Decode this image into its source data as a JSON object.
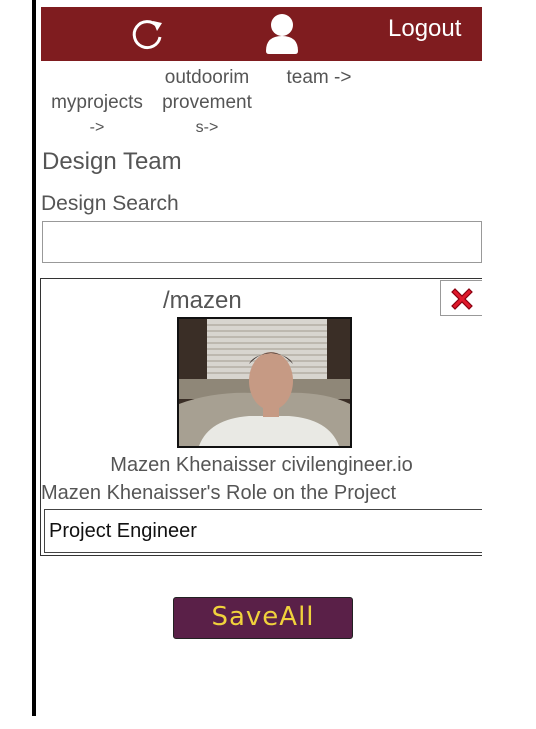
{
  "header": {
    "refresh_icon": "refresh-icon",
    "user_icon": "user-icon",
    "logout_label": "Logout",
    "bg_color": "#7f1c1f"
  },
  "breadcrumbs": [
    {
      "lines": [
        "myprojects",
        "->"
      ]
    },
    {
      "lines": [
        "outdoorim",
        "provement",
        "s->"
      ]
    },
    {
      "lines": [
        "team ->"
      ]
    }
  ],
  "page_title": "Design Team",
  "search": {
    "label": "Design Search",
    "value": "",
    "placeholder": ""
  },
  "member": {
    "handle": "/mazen",
    "close_icon": "close-x-icon",
    "name_line": "Mazen Khenaisser civilengineer.io",
    "role_label": "Mazen Khenaisser's Role on the Project",
    "role_value": "Project Engineer"
  },
  "save_all_label": "SaveAll",
  "colors": {
    "save_bg": "#5a2048",
    "save_text": "#f0d23c",
    "close_x": "#e0192b"
  }
}
